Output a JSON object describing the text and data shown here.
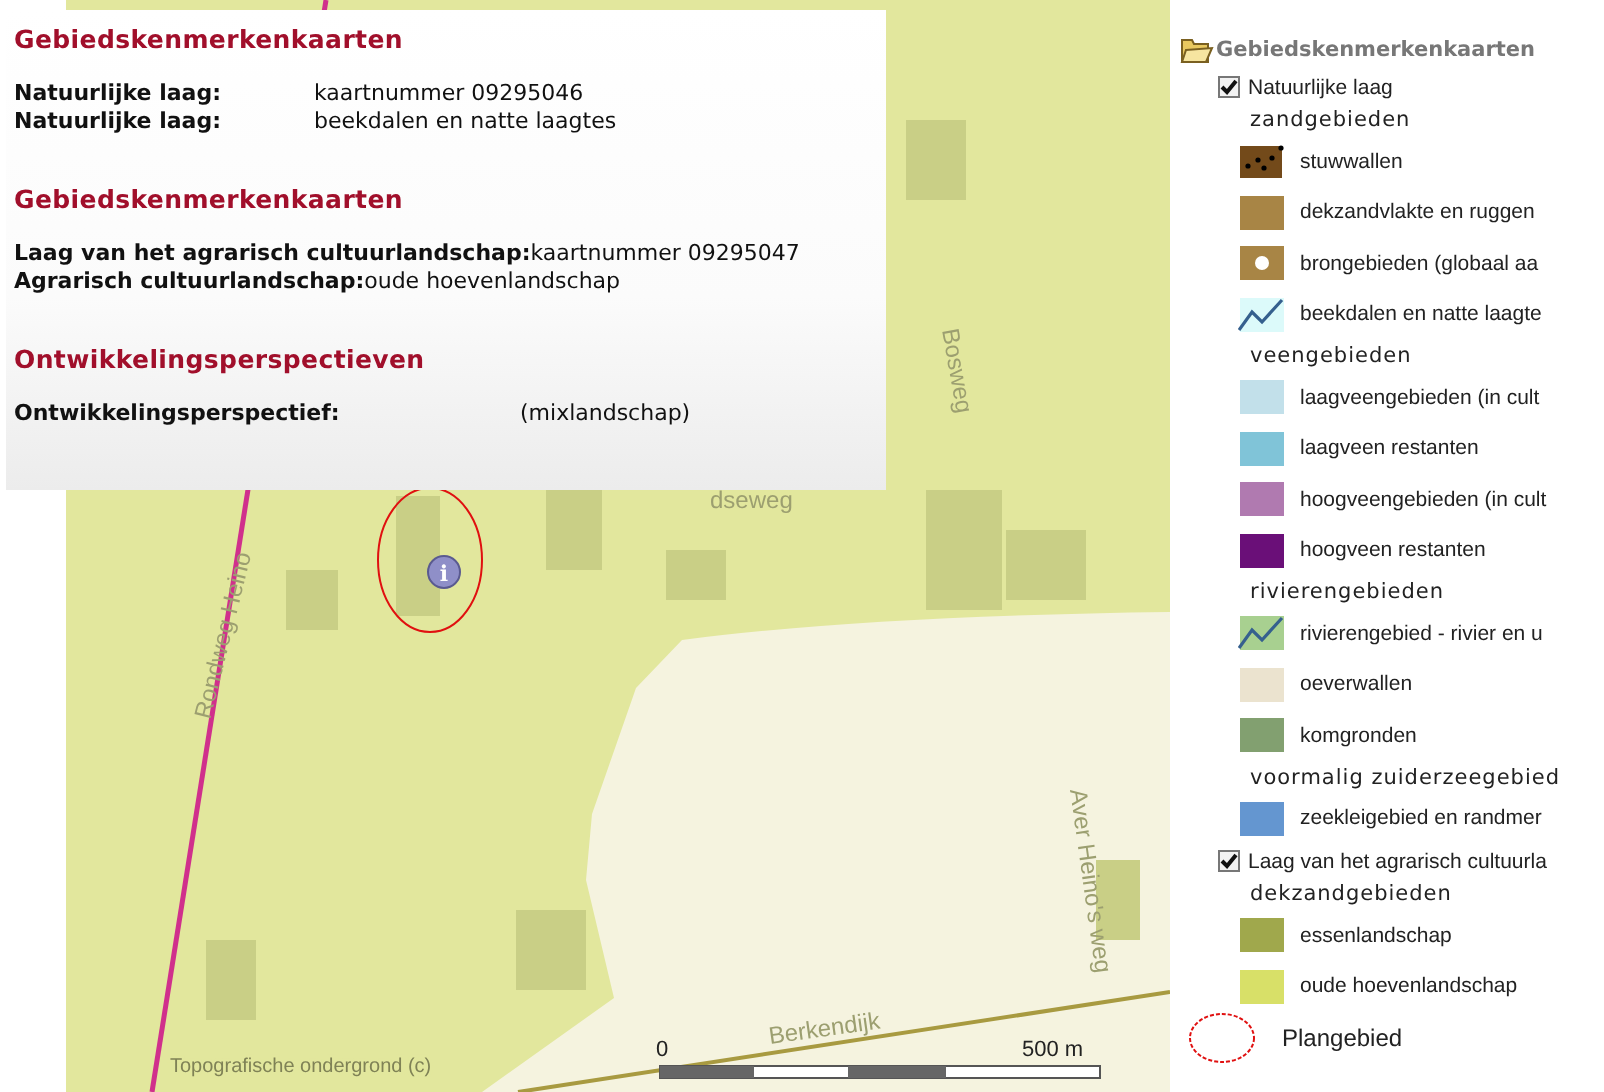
{
  "popup": {
    "sections": [
      {
        "title": "Gebiedskenmerkenkaarten",
        "kind": "table",
        "rows": [
          {
            "label": "Natuurlijke laag:",
            "value": "kaartnummer 09295046"
          },
          {
            "label": "Natuurlijke laag:",
            "value": "beekdalen en natte laagtes"
          }
        ]
      },
      {
        "title": "Gebiedskenmerkenkaarten",
        "kind": "inline",
        "rows": [
          {
            "label": "Laag van het agrarisch cultuurlandschap:",
            "value": "kaartnummer 09295047"
          },
          {
            "label": "Agrarisch cultuurlandschap:",
            "value": "oude hoevenlandschap"
          }
        ]
      },
      {
        "title": "Ontwikkelingsperspectieven",
        "kind": "wide",
        "rows": [
          {
            "label": "Ontwikkelingsperspectief:",
            "value": "(mixlandschap)"
          }
        ]
      }
    ]
  },
  "map": {
    "roads": [
      {
        "kind": "rondweg",
        "label": "Rondweg Heino"
      },
      {
        "kind": "bosweg",
        "label": "Bosweg"
      },
      {
        "kind": "dseweg",
        "label": "dseweg"
      },
      {
        "kind": "aver",
        "label": "Aver Heino's weg"
      },
      {
        "kind": "berkendijk",
        "label": "Berkendijk"
      }
    ],
    "info_marker": {
      "symbol": "i"
    },
    "scale": {
      "start": "0",
      "end": "500 m"
    },
    "attribution": "Topografische ondergrond (c)"
  },
  "legend": {
    "title": "Gebiedskenmerkenkaarten",
    "layers": [
      {
        "label": "Natuurlijke laag",
        "checked": true,
        "groups": [
          {
            "heading": "zandgebieden",
            "items": [
              {
                "label": "stuwwallen",
                "kind": "dots",
                "color": "#734a1a"
              },
              {
                "label": "dekzandvlakte en ruggen",
                "kind": "fill",
                "color": "#a88545"
              },
              {
                "label": "brongebieden (globaal aa",
                "kind": "spring",
                "color": "#a88545"
              },
              {
                "label": "beekdalen en natte laagte",
                "kind": "line",
                "color": "#dcfafa"
              }
            ]
          },
          {
            "heading": "veengebieden",
            "items": [
              {
                "label": "laagveengebieden (in cult",
                "kind": "fill",
                "color": "#c2e0ea"
              },
              {
                "label": "laagveen restanten",
                "kind": "fill",
                "color": "#80c4d8"
              },
              {
                "label": "hoogveengebieden (in cult",
                "kind": "fill",
                "color": "#b07ab0"
              },
              {
                "label": "hoogveen restanten",
                "kind": "fill",
                "color": "#6a0f78"
              }
            ]
          },
          {
            "heading": "rivierengebieden",
            "items": [
              {
                "label": "rivierengebied - rivier en u",
                "kind": "line",
                "color": "#a8d090"
              },
              {
                "label": "oeverwallen",
                "kind": "fill",
                "color": "#ebe3cf"
              },
              {
                "label": "komgronden",
                "kind": "fill",
                "color": "#82a070"
              }
            ]
          },
          {
            "heading": "voormalig zuiderzeegebied",
            "items": [
              {
                "label": "zeekleigebied en randmer",
                "kind": "fill",
                "color": "#6496d0"
              }
            ]
          }
        ]
      },
      {
        "label": "Laag van het agrarisch cultuurla",
        "checked": true,
        "groups": [
          {
            "heading": "dekzandgebieden",
            "items": [
              {
                "label": "essenlandschap",
                "kind": "fill",
                "color": "#a0a84c"
              },
              {
                "label": "oude hoevenlandschap",
                "kind": "fill",
                "color": "#d8e068"
              }
            ]
          }
        ]
      }
    ],
    "plan_area": {
      "label": "Plangebied"
    }
  }
}
